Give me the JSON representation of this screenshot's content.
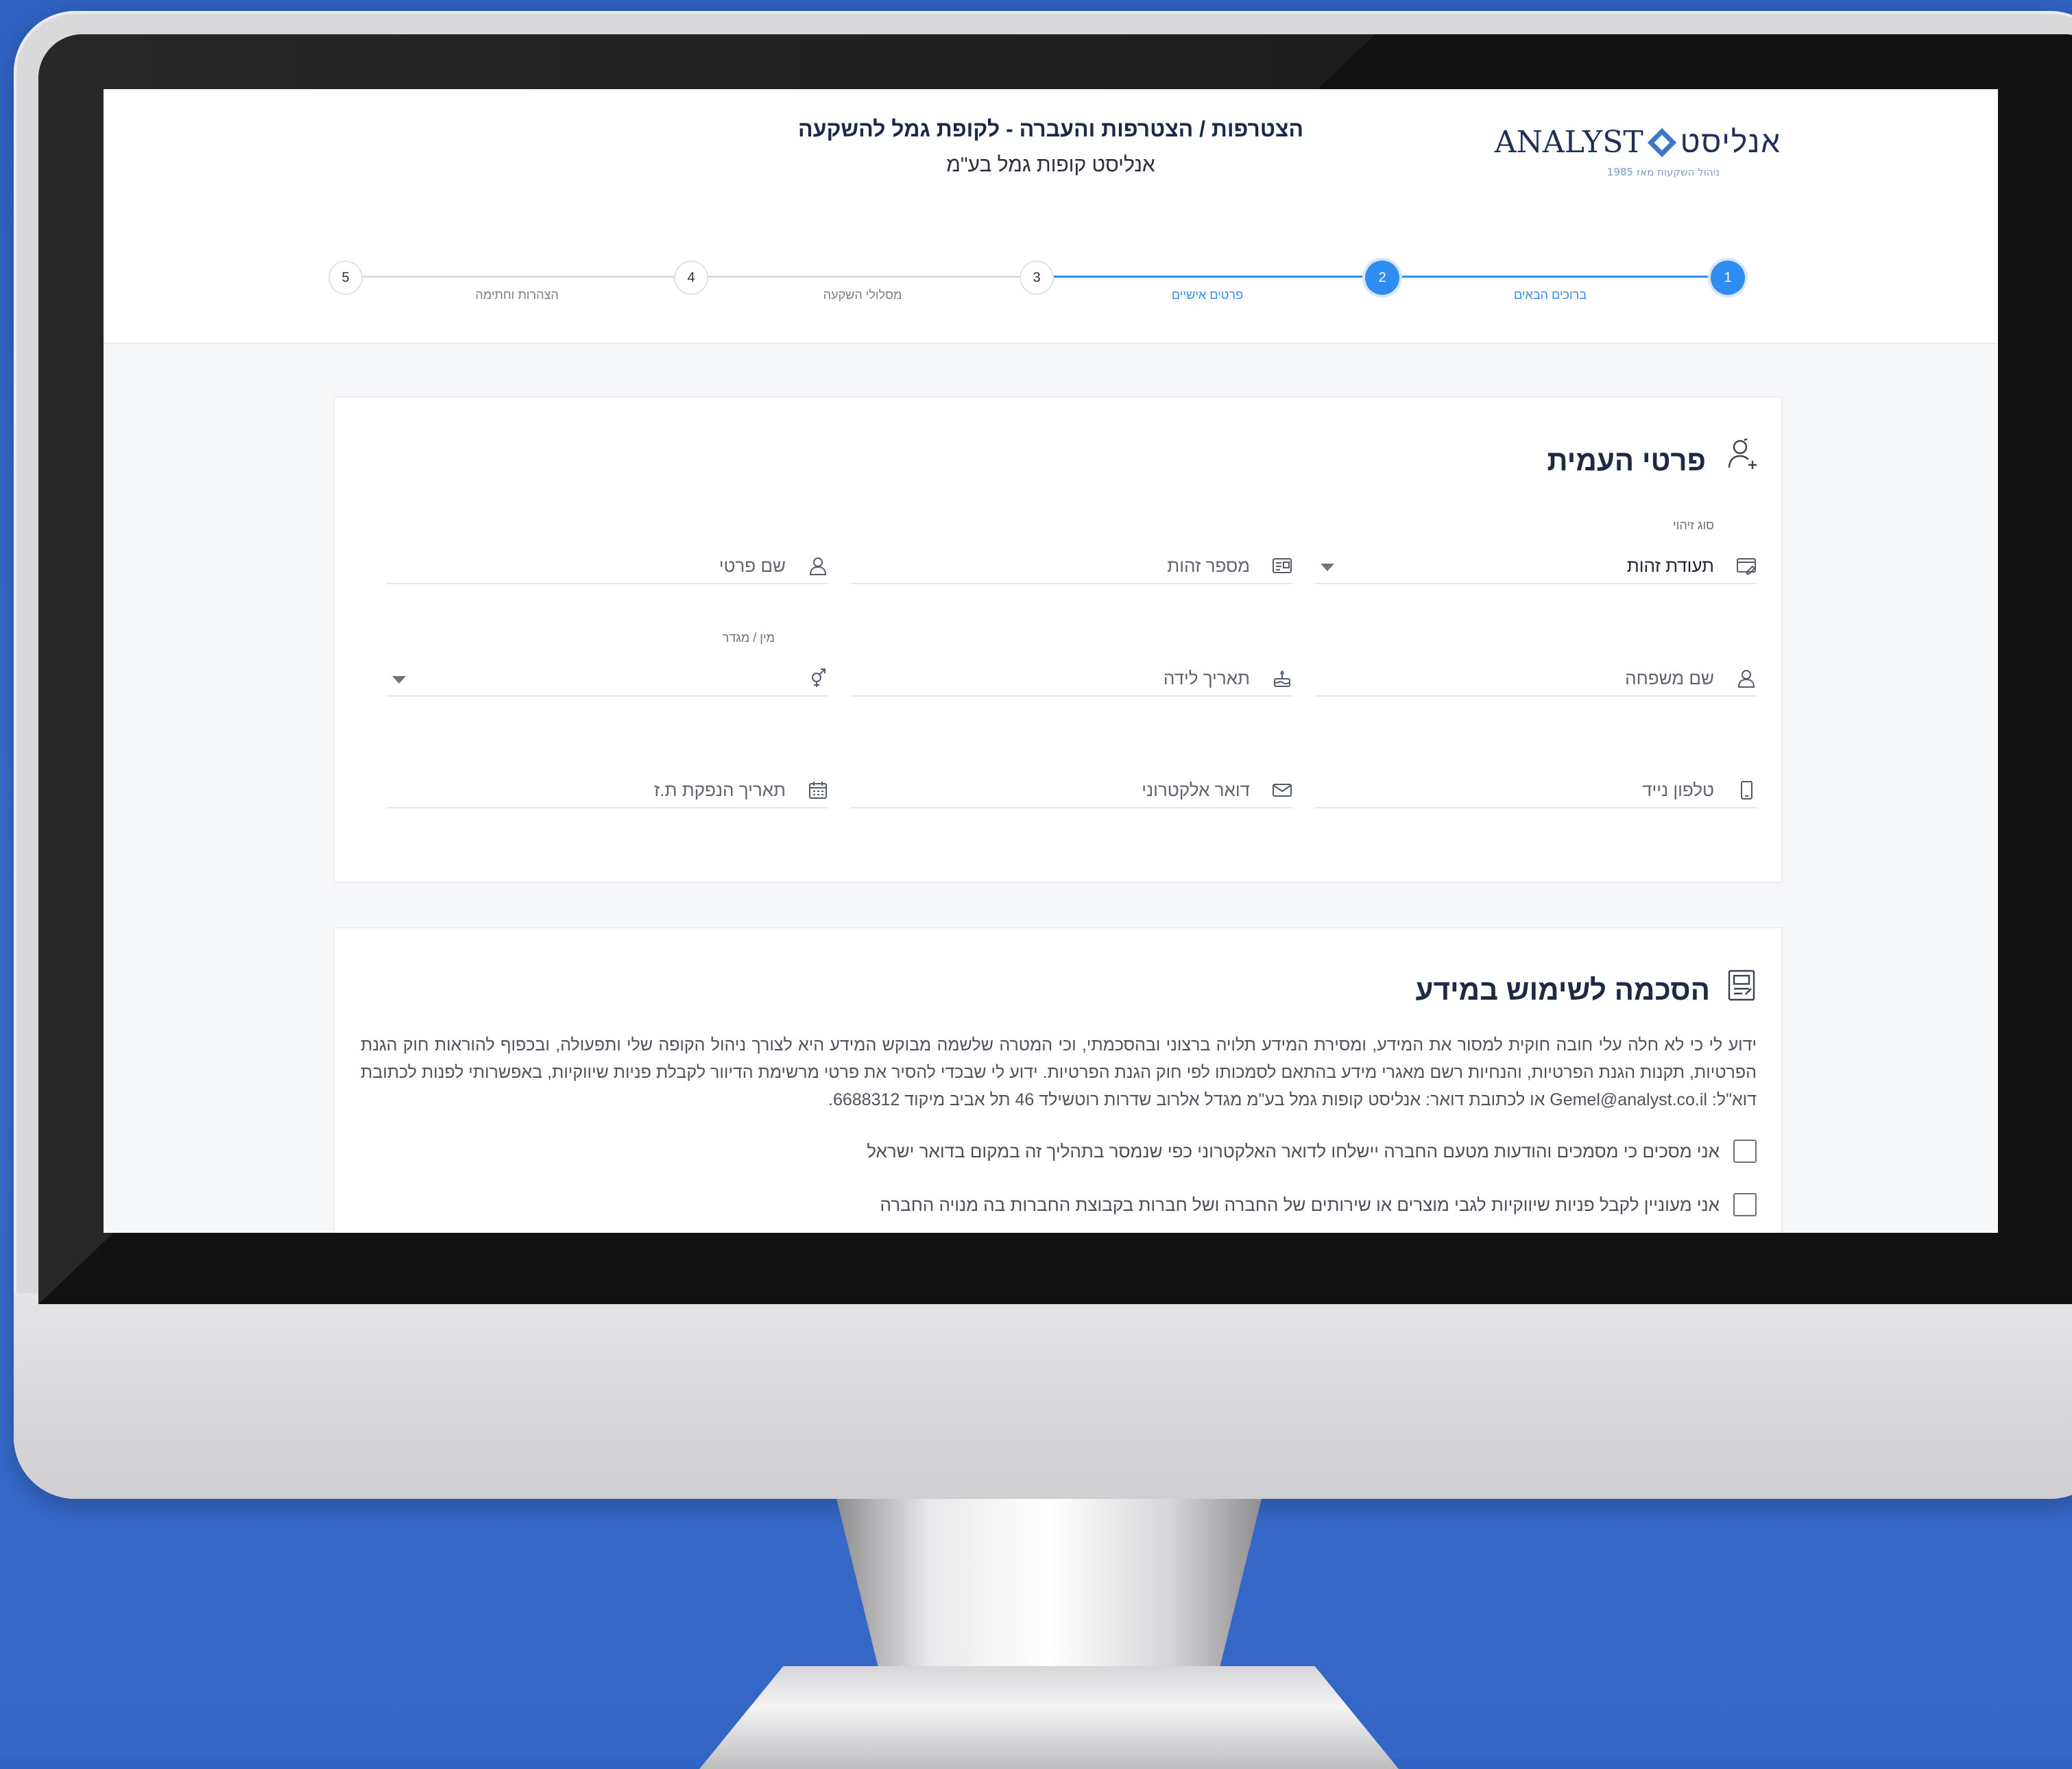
{
  "header": {
    "title": "הצטרפות / הצטרפות והעברה - לקופת גמל להשקעה",
    "subtitle": "אנליסט קופות גמל בע\"מ",
    "logo_en": "ANALYST",
    "logo_he": "אנליסט",
    "logo_tagline": "ניהול השקעות מאז 1985"
  },
  "stepper": {
    "steps": [
      {
        "number": "1",
        "label": "ברוכים הבאים",
        "state": "done"
      },
      {
        "number": "2",
        "label": "פרטים אישיים",
        "state": "done"
      },
      {
        "number": "3",
        "label": "מסלולי השקעה",
        "state": "todo"
      },
      {
        "number": "4",
        "label": "הצהרות וחתימה",
        "state": "todo"
      },
      {
        "number": "5",
        "label": "",
        "state": "todo"
      }
    ]
  },
  "details_card": {
    "title": "פרטי העמית",
    "id_type_label": "סוג זיהוי",
    "id_type_value": "תעודת זהות",
    "id_number_placeholder": "מספר זהות",
    "first_name_placeholder": "שם פרטי",
    "last_name_placeholder": "שם משפחה",
    "birth_date_placeholder": "תאריך לידה",
    "gender_label": "מין / מגדר",
    "gender_value": "",
    "mobile_placeholder": "טלפון נייד",
    "email_placeholder": "דואר אלקטרוני",
    "id_issue_date_placeholder": "תאריך הנפקת ת.ז"
  },
  "consent_card": {
    "title": "הסכמה לשימוש במידע",
    "text": "ידוע לי כי לא חלה עלי חובה חוקית למסור את המידע, ומסירת המידע תלויה ברצוני ובהסכמתי, וכי המטרה שלשמה מבוקש המידע היא לצורך ניהול הקופה שלי ותפעולה, ובכפוף להוראות חוק הגנת הפרטיות, תקנות הגנת הפרטיות, והנחיות רשם מאגרי מידע בהתאם לסמכותו לפי חוק הגנת הפרטיות. ידוע לי שבכדי להסיר את פרטי מרשימת הדיוור לקבלת פניות שיווקיות, באפשרותי לפנות לכתובת דוא\"ל: Gemel@analyst.co.il או לכתובת דואר: אנליסט קופות גמל בע\"מ מגדל אלרוב שדרות רוטשילד 46 תל אביב מיקוד 6688312.",
    "checkbox_1": "אני מסכים כי מסמכים והודעות מטעם החברה יישלחו לדואר האלקטרוני כפי שנמסר בתהליך זה במקום בדואר ישראל",
    "checkbox_2": "אני מעוניין לקבל פניות שיווקיות לגבי מוצרים או שירותים של החברה ושל חברות בקבוצת החברות בה מנויה החברה"
  },
  "colors": {
    "accent": "#2f8cf0",
    "background": "#3466c6",
    "title": "#1e2a44"
  }
}
